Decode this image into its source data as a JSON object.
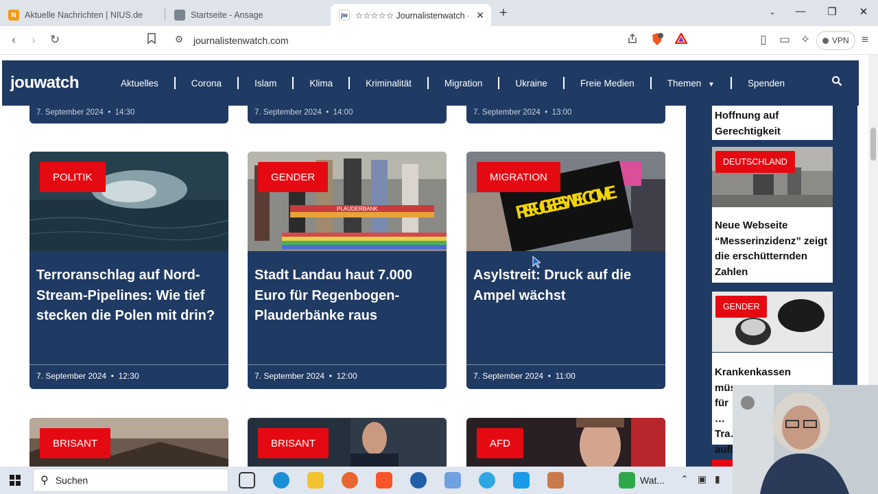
{
  "browser": {
    "tabs": [
      {
        "label": "Aktuelle Nachrichten | NIUS.de",
        "icon": "nius-favicon",
        "active": false
      },
      {
        "label": "Startseite - Ansage",
        "icon": "ansage-favicon",
        "active": false
      },
      {
        "label": "☆☆☆☆☆ Journalistenwatch - /",
        "icon": "jouwatch-favicon",
        "active": true
      }
    ],
    "url": "journalistenwatch.com",
    "vpn_label": "VPN",
    "brave_badge": "1"
  },
  "site": {
    "logo": "jouwatch",
    "nav": [
      "Aktuelles",
      "Corona",
      "Islam",
      "Klima",
      "Kriminalität",
      "Migration",
      "Ukraine",
      "Freie Medien",
      "Themen",
      "Spenden"
    ],
    "prev_dates": [
      {
        "date": "7. September 2024",
        "time": "14:30"
      },
      {
        "date": "7. September 2024",
        "time": "14:00"
      },
      {
        "date": "7. September 2024",
        "time": "13:00"
      }
    ],
    "cards": [
      {
        "badge": "POLITIK",
        "title": "Terroranschlag auf Nord-Stream-Pipelines: Wie tief stecken die Polen mit drin?",
        "date": "7. September 2024",
        "time": "12:30"
      },
      {
        "badge": "GENDER",
        "title": "Stadt Landau haut 7.000 Euro für Regenbogen-Plauderbänke raus",
        "date": "7. September 2024",
        "time": "12:00",
        "image_text": "PLAUDERBANK"
      },
      {
        "badge": "MIGRATION",
        "title": "Asylstreit: Druck auf die Ampel wächst",
        "date": "7. September 2024",
        "time": "11:00",
        "image_text": "REFUGEES WELCOME"
      }
    ],
    "next_badges": [
      "BRISANT",
      "BRISANT",
      "AFD"
    ],
    "sidebar": {
      "top_title": "Hoffnung auf Gerechtigkeit",
      "items": [
        {
          "badge": "DEUTSCHLAND",
          "title": "Neue Webseite “Messerinzidenz” zeigt die erschütternden Zahlen"
        },
        {
          "badge": "GENDER",
          "title": "Krankenkassen müs… für … Tra… aufl…"
        }
      ]
    }
  },
  "taskbar": {
    "search_placeholder": "Suchen",
    "active_app_label": "Wat..."
  }
}
